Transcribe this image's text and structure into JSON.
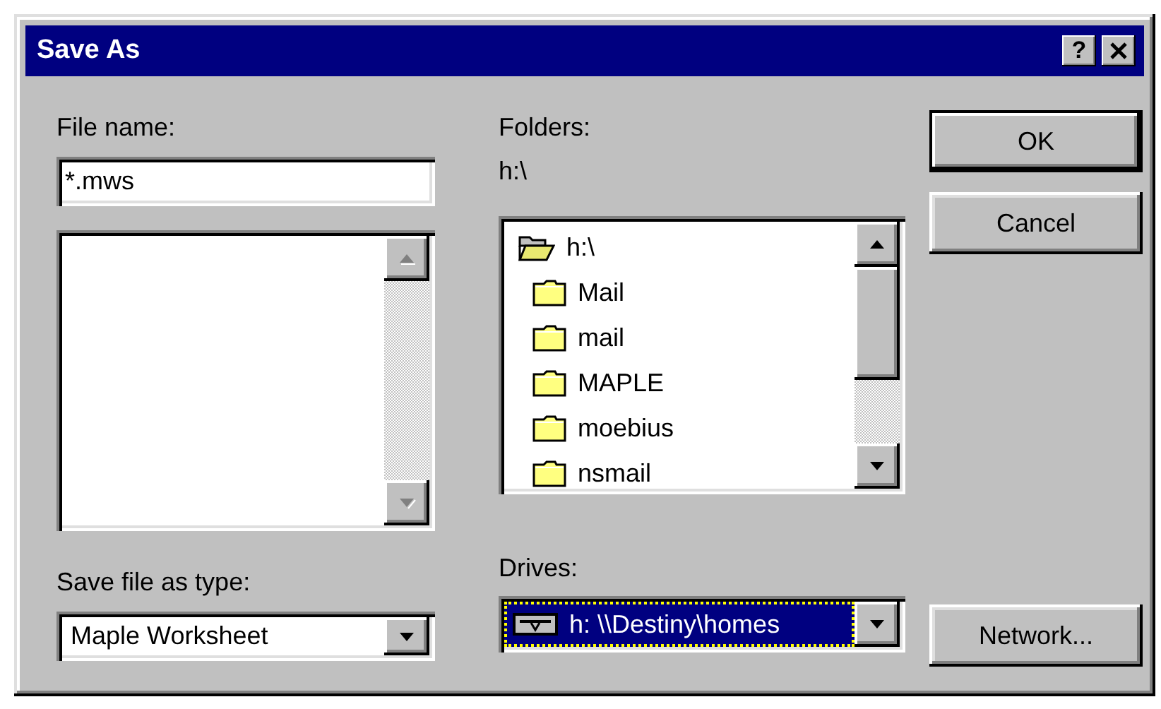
{
  "window": {
    "title": "Save As",
    "help_label": "?"
  },
  "file_name": {
    "label": "File name:",
    "value": "*.mws"
  },
  "save_type": {
    "label": "Save file as type:",
    "value": "Maple Worksheet"
  },
  "folders": {
    "label": "Folders:",
    "path": "h:\\",
    "items": [
      {
        "name": "h:\\",
        "expanded": true,
        "children": [
          {
            "name": "Mail",
            "expanded": false
          },
          {
            "name": "mail",
            "expanded": false
          },
          {
            "name": "MAPLE",
            "expanded": false
          },
          {
            "name": "moebius",
            "expanded": false
          },
          {
            "name": "nsmail",
            "expanded": false
          }
        ]
      }
    ]
  },
  "drives": {
    "label": "Drives:",
    "value": "h: \\\\Destiny\\homes",
    "selected": true
  },
  "buttons": [
    {
      "label": "OK",
      "default": true
    },
    {
      "label": "Cancel",
      "default": false
    },
    {
      "label": "Network...",
      "default": false
    }
  ]
}
